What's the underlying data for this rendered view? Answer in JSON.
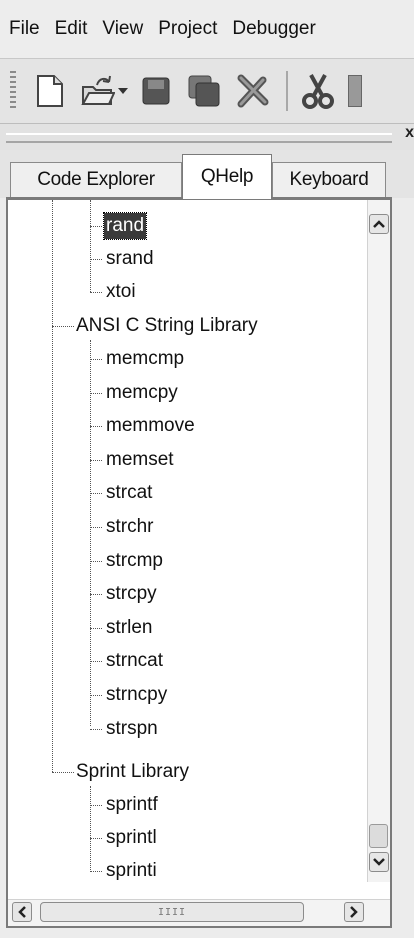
{
  "menubar": {
    "items": [
      "File",
      "Edit",
      "View",
      "Project",
      "Debugger"
    ]
  },
  "toolbar": {
    "buttons": [
      "new-file-icon",
      "open-icon",
      "dropdown-arrow-icon",
      "save-icon",
      "save-all-icon",
      "close-file-icon",
      "cut-icon"
    ]
  },
  "panel": {
    "close_glyph": "x"
  },
  "tabs": [
    {
      "label": "Code Explorer",
      "active": false
    },
    {
      "label": "QHelp",
      "active": true
    },
    {
      "label": "Keyboard",
      "active": false
    }
  ],
  "tree": {
    "group1_items": [
      "rand",
      "srand",
      "xtoi"
    ],
    "group2": {
      "label": "ANSI C String Library",
      "items": [
        "memcmp",
        "memcpy",
        "memmove",
        "memset",
        "strcat",
        "strchr",
        "strcmp",
        "strcpy",
        "strlen",
        "strncat",
        "strncpy",
        "strspn"
      ]
    },
    "group3": {
      "label": "Sprint Library",
      "items": [
        "sprintf",
        "sprintl",
        "sprinti"
      ]
    },
    "selected": "rand"
  },
  "scrollbar": {
    "h_thumb_grip": "IIII"
  },
  "colors": {
    "selection_bg": "#3a3a3a",
    "panel_bg": "#ffffff",
    "chrome_bg": "#e4e4e4"
  }
}
